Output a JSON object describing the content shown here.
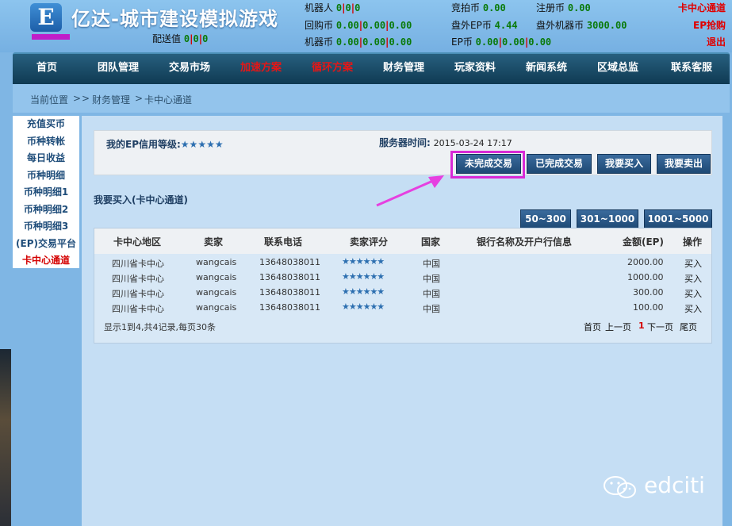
{
  "header": {
    "logo_letter": "E",
    "site_title": "亿达-城市建设模拟游戏",
    "delivery_label": "配送值",
    "delivery_values": [
      "0",
      "0",
      "0"
    ],
    "robot_label": "机器人",
    "robot_values": [
      "0",
      "0",
      "0"
    ],
    "buyback_label": "回购币",
    "buyback_values": [
      "0.00",
      "0.00",
      "0.00"
    ],
    "machine_label": "机器币",
    "machine_values": [
      "0.00",
      "0.00",
      "0.00"
    ],
    "auction_label": "竞拍币",
    "auction_value": "0.00",
    "offep_label": "盘外EP币",
    "offep_value": "4.44",
    "ep_label": "EP币",
    "ep_values": [
      "0.00",
      "0.00",
      "0.00"
    ],
    "register_label": "注册币",
    "register_value": "0.00",
    "offmachine_label": "盘外机器币",
    "offmachine_value": "3000.00",
    "links": {
      "card_center": "卡中心通道",
      "ep_grab": "EP抢购",
      "logout": "退出"
    }
  },
  "nav": [
    "首页",
    "团队管理",
    "交易市场",
    "加速方案",
    "循环方案",
    "财务管理",
    "玩家资料",
    "新闻系统",
    "区域总监",
    "联系客服"
  ],
  "breadcrumb": {
    "label": "当前位置",
    "sep": ">",
    "items": [
      "财务管理",
      "卡中心通道"
    ]
  },
  "sidebar": [
    "充值买币",
    "币种转帐",
    "每日收益",
    "币种明细",
    "币种明细1",
    "币种明细2",
    "币种明细3",
    "(EP)交易平台",
    "卡中心通道"
  ],
  "main": {
    "credit_label": "我的EP信用等级:",
    "credit_stars": "★★★★★",
    "server_time_label": "服务器时间:",
    "server_time": "2015-03-24 17:17",
    "buttons": [
      "未完成交易",
      "已完成交易",
      "我要买入",
      "我要卖出"
    ],
    "section_title": "我要买入(卡中心通道)",
    "filters": [
      "50~300",
      "301~1000",
      "1001~5000"
    ],
    "table": {
      "headers": [
        "卡中心地区",
        "卖家",
        "联系电话",
        "卖家评分",
        "国家",
        "银行名称及开户行信息",
        "金额(EP)",
        "操作"
      ],
      "rows": [
        [
          "四川省卡中心",
          "wangcais",
          "13648038011",
          "★★★★★★",
          "中国",
          "",
          "2000.00",
          "买入"
        ],
        [
          "四川省卡中心",
          "wangcais",
          "13648038011",
          "★★★★★★",
          "中国",
          "",
          "1000.00",
          "买入"
        ],
        [
          "四川省卡中心",
          "wangcais",
          "13648038011",
          "★★★★★★",
          "中国",
          "",
          "300.00",
          "买入"
        ],
        [
          "四川省卡中心",
          "wangcais",
          "13648038011",
          "★★★★★★",
          "中国",
          "",
          "100.00",
          "买入"
        ]
      ],
      "summary": "显示1到4,共4记录,每页30条",
      "pager": {
        "first": "首页",
        "prev": "上一页",
        "current": "1",
        "next": "下一页",
        "last": "尾页"
      }
    }
  },
  "watermark": "edciti",
  "colors": {
    "accent_red": "#e00000",
    "nav_bg": "#1b4f6d",
    "highlight": "#d82ad6",
    "button": "#2a5886"
  }
}
